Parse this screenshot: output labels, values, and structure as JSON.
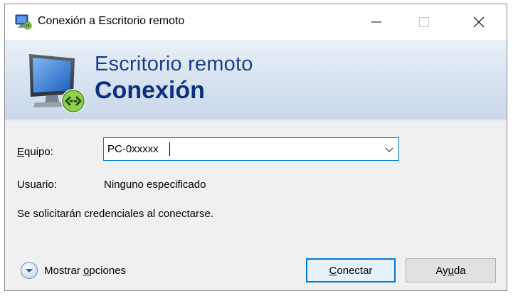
{
  "window": {
    "title": "Conexión a Escritorio remoto"
  },
  "titlebar": {
    "icons": [
      "remote-desktop-app-icon",
      "minimize-icon",
      "maximize-icon",
      "close-icon"
    ]
  },
  "banner": {
    "line1": "Escritorio remoto",
    "line2": "Conexión",
    "icon": "remote-desktop-monitor-icon"
  },
  "form": {
    "computer_label_mnemonic": "E",
    "computer_label_rest": "quipo:",
    "computer_value": "PC-0xxxxx",
    "user_label": "Usuario:",
    "user_value": "Ninguno especificado",
    "credentials_note": "Se solicitarán credenciales al conectarse."
  },
  "footer": {
    "options_label_prefix": "Mostrar ",
    "options_label_mnemonic": "o",
    "options_label_rest": "pciones",
    "connect_mnemonic": "C",
    "connect_rest": "onectar",
    "help_prefix": "Ay",
    "help_mnemonic": "u",
    "help_rest": "da"
  },
  "colors": {
    "accent": "#0078d7",
    "banner_title": "#1a3e8f",
    "banner_subtitle": "#0c2f7e"
  }
}
